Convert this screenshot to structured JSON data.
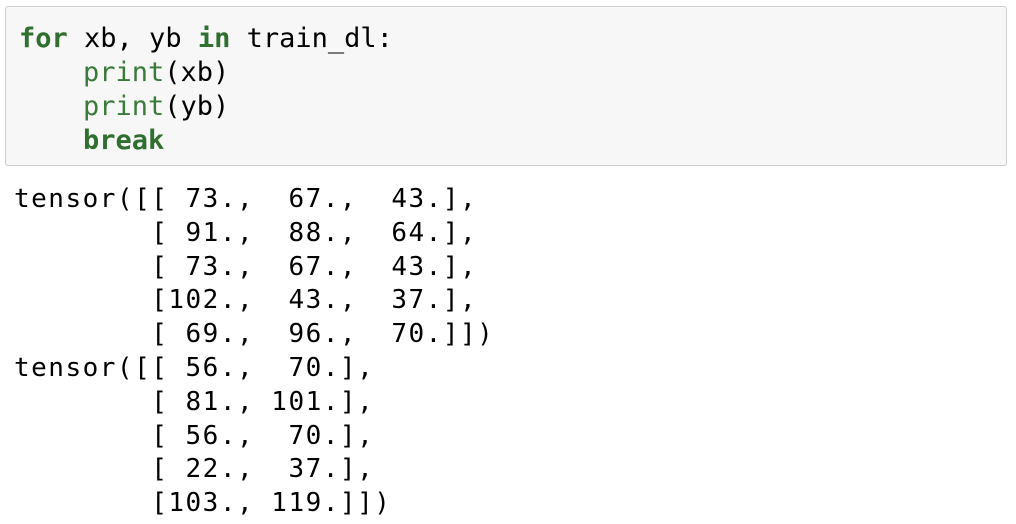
{
  "code_cell": {
    "line1": {
      "kw_for": "for",
      "vars": " xb, yb ",
      "kw_in": "in",
      "iter": " train_dl:"
    },
    "line2": {
      "func": "print",
      "args": "(xb)"
    },
    "line3": {
      "func": "print",
      "args": "(yb)"
    },
    "line4": {
      "kw_break": "break"
    }
  },
  "output": {
    "lines": [
      "tensor([[ 73.,  67.,  43.],",
      "        [ 91.,  88.,  64.],",
      "        [ 73.,  67.,  43.],",
      "        [102.,  43.,  37.],",
      "        [ 69.,  96.,  70.]])",
      "tensor([[ 56.,  70.],",
      "        [ 81., 101.],",
      "        [ 56.,  70.],",
      "        [ 22.,  37.],",
      "        [103., 119.]])"
    ]
  }
}
